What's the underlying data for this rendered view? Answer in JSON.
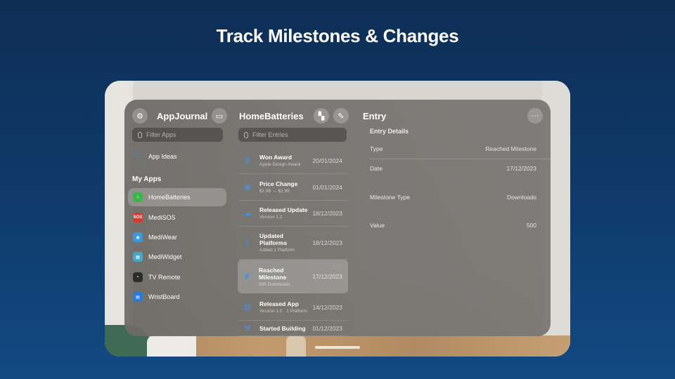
{
  "headline": "Track Milestones & Changes",
  "sidebar": {
    "title": "AppJournal",
    "search_placeholder": "Filter Apps",
    "top_item": "App Ideas",
    "section": "My Apps",
    "apps": [
      {
        "label": "HomeBatteries",
        "color": "#3bb54a",
        "glyph": "⌂"
      },
      {
        "label": "MediSOS",
        "color": "#d9382f",
        "glyph": "SOS"
      },
      {
        "label": "MediWear",
        "color": "#3a9ad9",
        "glyph": "◉"
      },
      {
        "label": "MediWidget",
        "color": "#47a9c9",
        "glyph": "▦"
      },
      {
        "label": "TV Remote",
        "color": "#2c2c2c",
        "glyph": "▪"
      },
      {
        "label": "WristBoard",
        "color": "#2f79d6",
        "glyph": "▤"
      }
    ]
  },
  "list": {
    "title": "HomeBatteries",
    "search_placeholder": "Filter Entries",
    "entries": [
      {
        "name": "Won Award",
        "sub": "Apple Design Award",
        "date": "20/01/2024",
        "icon": "trophy-icon",
        "glyph": "♛"
      },
      {
        "name": "Price Change",
        "sub": "$1.99 → $2.99",
        "date": "01/01/2024",
        "icon": "price-tag-icon",
        "glyph": "▣"
      },
      {
        "name": "Released Update",
        "sub": "Version 1.1",
        "date": "18/12/2023",
        "icon": "cloud-upload-icon",
        "glyph": "☁"
      },
      {
        "name": "Updated Platforms",
        "sub": "Added 1 Platform",
        "date": "18/12/2023",
        "icon": "device-icon",
        "glyph": "▯"
      },
      {
        "name": "Reached Milestone",
        "sub": "500 Downloads",
        "date": "17/12/2023",
        "icon": "milestone-icon",
        "glyph": "♜"
      },
      {
        "name": "Released App",
        "sub": "Version 1.0 · 1 Platform",
        "date": "14/12/2023",
        "icon": "app-release-icon",
        "glyph": "▧"
      },
      {
        "name": "Started Building",
        "sub": "",
        "date": "01/12/2023",
        "icon": "hammer-icon",
        "glyph": "⚒"
      }
    ]
  },
  "detail": {
    "title": "Entry",
    "section": "Entry Details",
    "rows": [
      {
        "label": "Type",
        "value": "Reached Milestone"
      },
      {
        "label": "Date",
        "value": "17/12/2023"
      },
      {
        "label": "Milestone Type",
        "value": "Downloads"
      },
      {
        "label": "Value",
        "value": "500"
      }
    ],
    "more_glyph": "···"
  }
}
